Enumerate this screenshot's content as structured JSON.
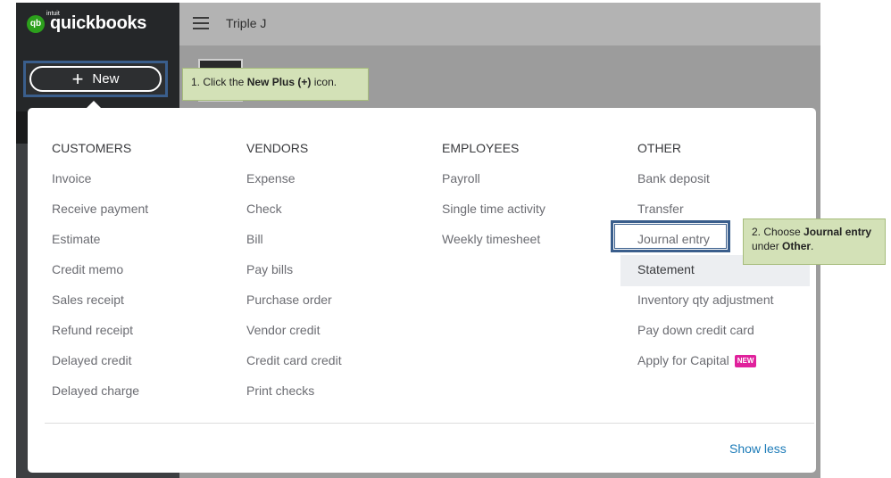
{
  "app": {
    "brand_small": "intuit",
    "brand": "quickbooks",
    "logo_badge": "qb",
    "company": "Triple J"
  },
  "new_button": {
    "label": "New",
    "icon": "plus-icon"
  },
  "callouts": {
    "step1": {
      "prefix": "1. Click the ",
      "bold": "New Plus (+)",
      "suffix": " icon."
    },
    "step2": {
      "prefix": "2. Choose ",
      "bold1": "Journal entry",
      "mid": " under ",
      "bold2": "Other",
      "suffix": "."
    }
  },
  "menu": {
    "columns": [
      {
        "heading": "CUSTOMERS",
        "items": [
          "Invoice",
          "Receive payment",
          "Estimate",
          "Credit memo",
          "Sales receipt",
          "Refund receipt",
          "Delayed credit",
          "Delayed charge"
        ]
      },
      {
        "heading": "VENDORS",
        "items": [
          "Expense",
          "Check",
          "Bill",
          "Pay bills",
          "Purchase order",
          "Vendor credit",
          "Credit card credit",
          "Print checks"
        ]
      },
      {
        "heading": "EMPLOYEES",
        "items": [
          "Payroll",
          "Single time activity",
          "Weekly timesheet"
        ]
      },
      {
        "heading": "OTHER",
        "items": [
          "Bank deposit",
          "Transfer",
          "Journal entry",
          "Statement",
          "Inventory qty adjustment",
          "Pay down credit card",
          "Apply for Capital"
        ]
      }
    ],
    "capital_badge": "NEW",
    "show_less": "Show less"
  },
  "colors": {
    "accent_link": "#1c7bb8",
    "brand_green": "#2ca01c",
    "new_badge": "#e0219c",
    "callout_bg": "#d3e1b7",
    "highlight_frame": "#3a5e8c"
  }
}
